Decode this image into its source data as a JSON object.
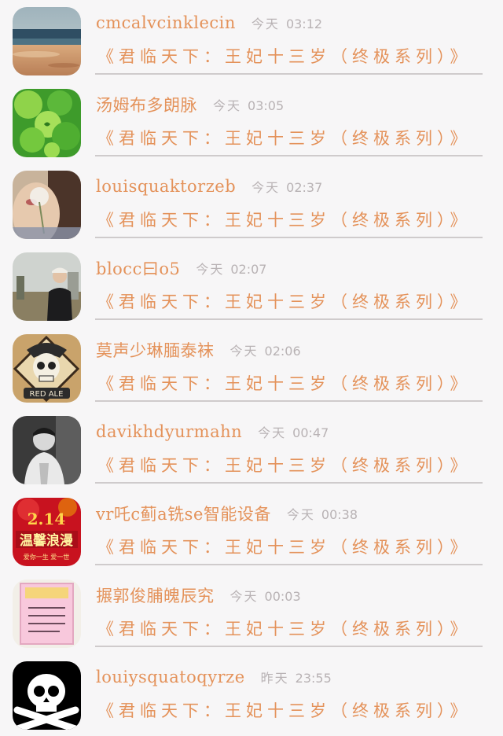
{
  "items": [
    {
      "username": "cmcalvcinklecin",
      "day": "今天",
      "time": "03:12",
      "message": "《君临天下：王妃十三岁（终极系列）》"
    },
    {
      "username": "汤姆布多朗脉",
      "day": "今天",
      "time": "03:05",
      "message": "《君临天下：王妃十三岁（终极系列）》"
    },
    {
      "username": "louisquaktorzeb",
      "day": "今天",
      "time": "02:37",
      "message": "《君临天下：王妃十三岁（终极系列）》"
    },
    {
      "username": "blocc曰o5",
      "day": "今天",
      "time": "02:07",
      "message": "《君临天下：王妃十三岁（终极系列）》"
    },
    {
      "username": "莫声少琳腼泰袜",
      "day": "今天",
      "time": "02:06",
      "message": "《君临天下：王妃十三岁（终极系列）》",
      "avatar_text": "RED ALE"
    },
    {
      "username": "davikhdyurmahn",
      "day": "今天",
      "time": "00:47",
      "message": "《君临天下：王妃十三岁（终极系列）》"
    },
    {
      "username": "vr吒c蓟a铣se智能设备",
      "day": "今天",
      "time": "00:38",
      "message": "《君临天下：王妃十三岁（终极系列）》",
      "avatar_text": "2.14",
      "avatar_text2": "温馨浪漫",
      "avatar_text3": "爱你一生 爱一世"
    },
    {
      "username": "搌郭俊脯魄辰究",
      "day": "今天",
      "time": "00:03",
      "message": "《君临天下：王妃十三岁（终极系列）》"
    },
    {
      "username": "louiysquatoqyrze",
      "day": "昨天",
      "time": "23:55",
      "message": "《君临天下：王妃十三岁（终极系列）》"
    }
  ],
  "colors": {
    "accent": "#e4925a",
    "meta": "#b8b2b4",
    "divider": "#cfcbcc",
    "background": "#f7f6f7"
  },
  "avatars": [
    "beach-photo",
    "clover-photo",
    "girl-dandelion-photo",
    "man-street-photo",
    "skull-red-ale-badge",
    "man-bw-photo",
    "valentine-card",
    "pink-greeting-card",
    "skull-crossbones-icon"
  ]
}
